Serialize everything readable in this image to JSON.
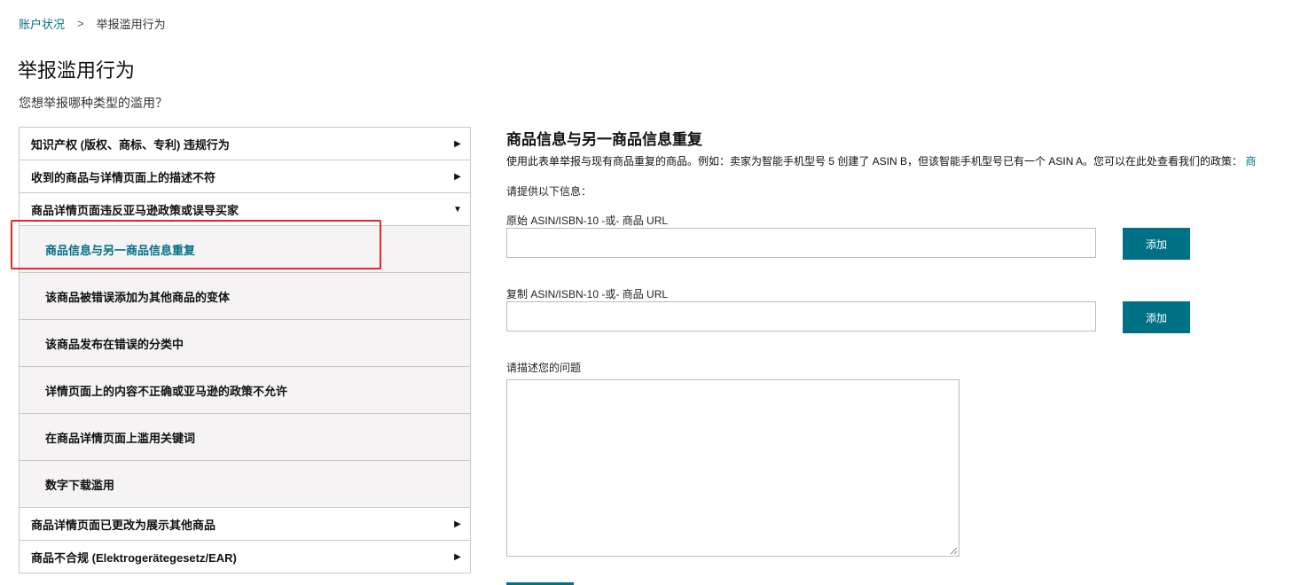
{
  "breadcrumb": {
    "parent": "账户状况",
    "separator": ">",
    "current": "举报滥用行为"
  },
  "page": {
    "title": "举报滥用行为",
    "subtitle": "您想举报哪种类型的滥用？"
  },
  "menu": {
    "items_top": [
      {
        "label": "知识产权 (版权、商标、专利) 违规行为",
        "arrow": "▶"
      },
      {
        "label": "收到的商品与详情页面上的描述不符",
        "arrow": "▶"
      },
      {
        "label": "商品详情页面违反亚马逊政策或误导买家",
        "arrow": "▼"
      }
    ],
    "sub_items": [
      {
        "label": "商品信息与另一商品信息重复"
      },
      {
        "label": "该商品被错误添加为其他商品的变体"
      },
      {
        "label": "该商品发布在错误的分类中"
      },
      {
        "label": "详情页面上的内容不正确或亚马逊的政策不允许"
      },
      {
        "label": "在商品详情页面上滥用关键词"
      },
      {
        "label": "数字下载滥用"
      }
    ],
    "items_bottom": [
      {
        "label": "商品详情页面已更改为展示其他商品",
        "arrow": "▶"
      },
      {
        "label": "商品不合规 (Elektrogerätegesetz/EAR)",
        "arrow": "▶"
      }
    ]
  },
  "form": {
    "title": "商品信息与另一商品信息重复",
    "description": "使用此表单举报与现有商品重复的商品。例如：卖家为智能手机型号 5 创建了 ASIN B，但该智能手机型号已有一个 ASIN A。您可以在此处查看我们的政策：",
    "description_link": "商",
    "prompt": "请提供以下信息：",
    "original_label": "原始 ASIN/ISBN-10 -或- 商品 URL",
    "original_value": "",
    "duplicate_label": "复制 ASIN/ISBN-10 -或- 商品 URL",
    "duplicate_value": "",
    "add_label": "添加",
    "issue_label": "请描述您的问题",
    "issue_value": ""
  },
  "colors": {
    "link": "#007185",
    "button": "#007185",
    "highlight": "#e8261f",
    "sub_bg": "#f6f3f5"
  }
}
